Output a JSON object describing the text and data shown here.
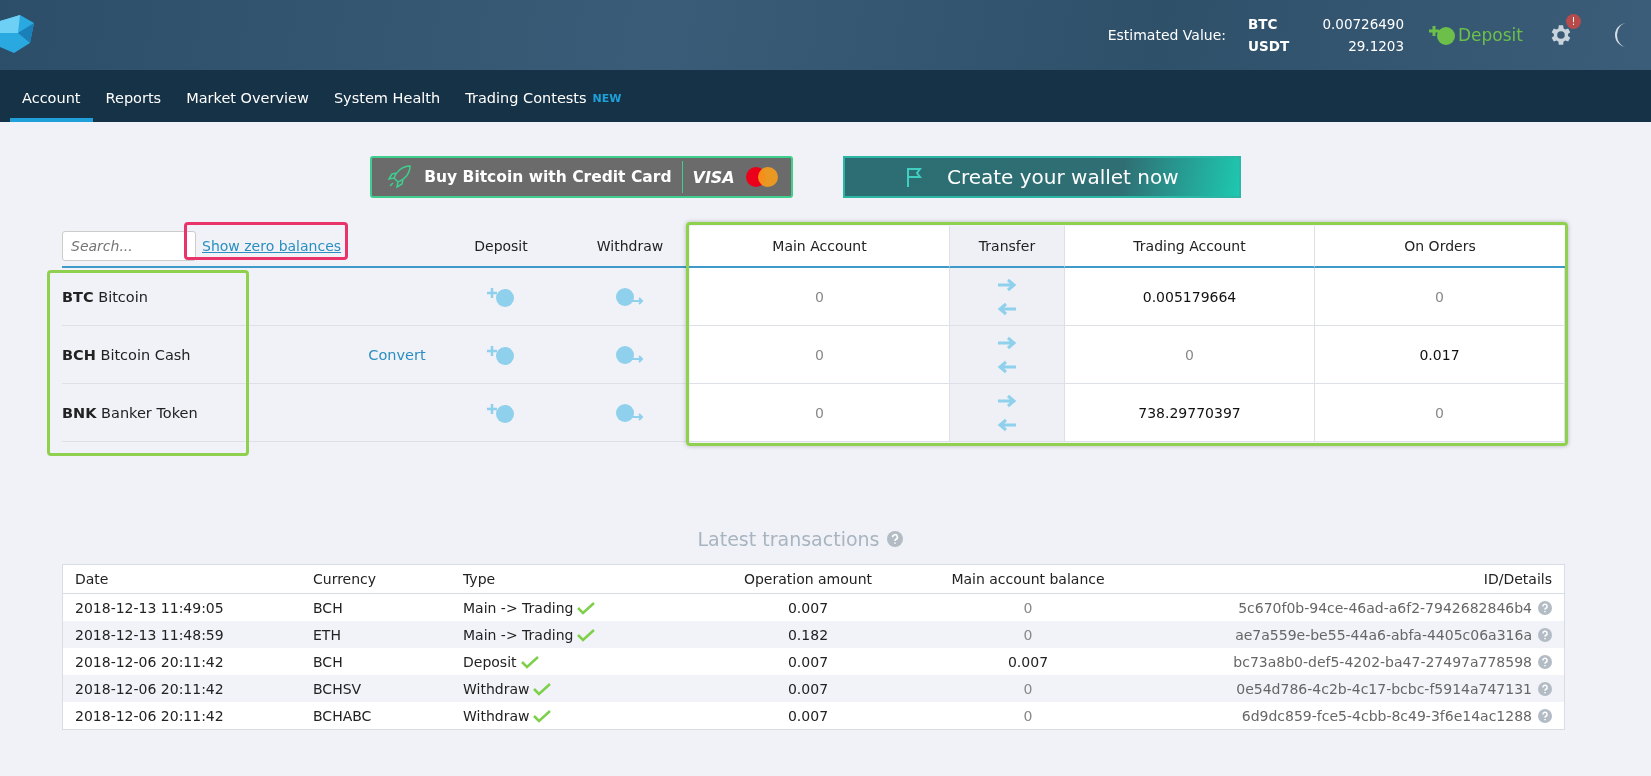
{
  "header": {
    "estimated_label": "Estimated Value:",
    "balances": [
      {
        "currency": "BTC",
        "value": "0.00726490"
      },
      {
        "currency": "USDT",
        "value": "29.1203"
      }
    ],
    "deposit_button": "Deposit",
    "alert_badge": "!"
  },
  "nav": [
    {
      "label": "Account",
      "selected": true
    },
    {
      "label": "Reports",
      "selected": false
    },
    {
      "label": "Market Overview",
      "selected": false
    },
    {
      "label": "System Health",
      "selected": false
    },
    {
      "label": "Trading Contests",
      "selected": false,
      "badge": "NEW"
    }
  ],
  "promo": {
    "buy_button": "Buy Bitcoin with Credit Card",
    "card_brand": "VISA",
    "wallet_button": "Create your wallet now"
  },
  "balances": {
    "search_placeholder": "Search...",
    "zero_link": "Show zero balances",
    "columns": [
      "Deposit",
      "Withdraw",
      "Main Account",
      "Transfer",
      "Trading Account",
      "On Orders"
    ],
    "rows": [
      {
        "symbol": "BTC",
        "name": "Bitcoin",
        "main": {
          "text": "0",
          "muted": true
        },
        "trading": {
          "text": "0.005179664",
          "muted": false
        },
        "orders": {
          "text": "0",
          "muted": true
        }
      },
      {
        "symbol": "BCH",
        "name": "Bitcoin Cash",
        "convert": "Convert",
        "main": {
          "text": "0",
          "muted": true
        },
        "trading": {
          "text": "0",
          "muted": true
        },
        "orders": {
          "text": "0.017",
          "muted": false
        }
      },
      {
        "symbol": "BNK",
        "name": "Banker Token",
        "main": {
          "text": "0",
          "muted": true
        },
        "trading": {
          "text": "738.29770397",
          "muted": false
        },
        "orders": {
          "text": "0",
          "muted": true
        }
      }
    ]
  },
  "transactions": {
    "title": "Latest transactions",
    "columns": [
      "Date",
      "Currency",
      "Type",
      "Operation amount",
      "Main account balance",
      "ID/Details"
    ],
    "rows": [
      {
        "date": "2018-12-13 11:49:05",
        "currency": "BCH",
        "type": "Main -> Trading",
        "confirmed": true,
        "amount": "0.007",
        "balance": {
          "text": "0",
          "muted": true
        },
        "id": "5c670f0b-94ce-46ad-a6f2-7942682846b4"
      },
      {
        "date": "2018-12-13 11:48:59",
        "currency": "ETH",
        "type": "Main -> Trading",
        "confirmed": true,
        "amount": "0.182",
        "balance": {
          "text": "0",
          "muted": true
        },
        "id": "ae7a559e-be55-44a6-abfa-4405c06a316a"
      },
      {
        "date": "2018-12-06 20:11:42",
        "currency": "BCH",
        "type": "Deposit",
        "confirmed": true,
        "amount": "0.007",
        "balance": {
          "text": "0.007",
          "muted": false
        },
        "id": "bc73a8b0-def5-4202-ba47-27497a778598"
      },
      {
        "date": "2018-12-06 20:11:42",
        "currency": "BCHSV",
        "type": "Withdraw",
        "confirmed": true,
        "amount": "0.007",
        "balance": {
          "text": "0",
          "muted": true
        },
        "id": "0e54d786-4c2b-4c17-bcbc-f5914a747131"
      },
      {
        "date": "2018-12-06 20:11:42",
        "currency": "BCHABC",
        "type": "Withdraw",
        "confirmed": true,
        "amount": "0.007",
        "balance": {
          "text": "0",
          "muted": true
        },
        "id": "6d9dc859-fce5-4cbb-8c49-3f6e14ac1288"
      }
    ]
  }
}
